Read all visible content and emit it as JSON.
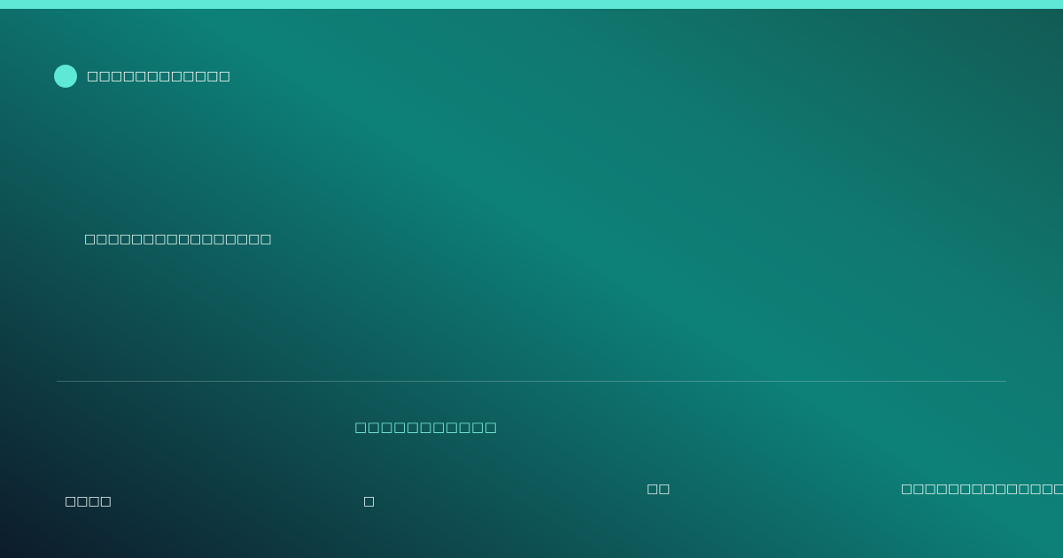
{
  "colors": {
    "accent": "#5ee8d6",
    "accent_text": "#7ff0df",
    "text": "#ffffff",
    "background_dark": "#0d1b2a",
    "background_teal": "#0d8178"
  },
  "brand": {
    "logo_icon": "circle-dot-icon",
    "name": "□□□□□□□□□□□□"
  },
  "hero": {
    "headline": "□□□□□□□□□□□□□□□□"
  },
  "footer": {
    "accent_label": "□□□□□□□□□□□",
    "left_text": "□□□□",
    "center_text": "□",
    "mid_text": "□□",
    "right_text": "□□□□□□□□□□□□□□□□□"
  }
}
